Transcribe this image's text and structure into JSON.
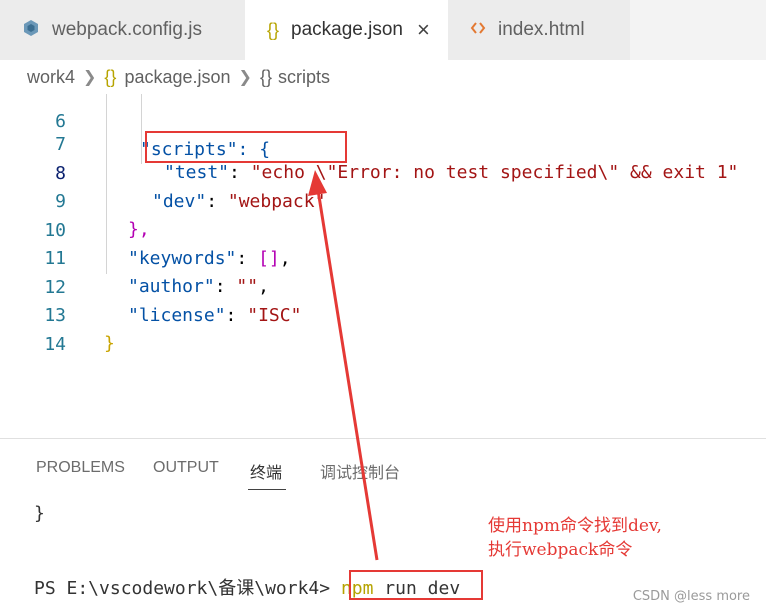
{
  "tabs": [
    {
      "label": "webpack.config.js",
      "icon": "webpack-icon",
      "active": false
    },
    {
      "label": "package.json",
      "icon": "json-braces-icon",
      "active": true
    },
    {
      "label": "index.html",
      "icon": "html-code-icon",
      "active": false
    }
  ],
  "tab_close_glyph": "×",
  "breadcrumb": {
    "root": "work4",
    "file_icon_glyph": "{}",
    "file": "package.json",
    "symbol_icon_glyph": "{}",
    "symbol": "scripts"
  },
  "editor": {
    "partial_line_number": "6",
    "partial_line_text": "\"scripts\": {",
    "lines": [
      {
        "n": "7",
        "key": "\"test\"",
        "value": "\"echo \\\"Error: no test specified\\\" && exit 1\""
      },
      {
        "n": "8",
        "key": "\"dev\"",
        "value": "\"webpack\""
      },
      {
        "n": "9",
        "text": "},"
      },
      {
        "n": "10",
        "key": "\"keywords\"",
        "value": "[]"
      },
      {
        "n": "11",
        "key": "\"author\"",
        "value": "\"\""
      },
      {
        "n": "12",
        "key": "\"license\"",
        "value": "\"ISC\""
      },
      {
        "n": "13",
        "text": "}"
      },
      {
        "n": "14",
        "text": ""
      }
    ]
  },
  "panel": {
    "tabs": [
      "PROBLEMS",
      "OUTPUT",
      "终端",
      "调试控制台"
    ],
    "active_tab": "终端",
    "terminal": {
      "brace_line": "}",
      "prompt": "PS E:\\vscodework\\备课\\work4>",
      "command_program": "npm",
      "command_args": "run dev"
    }
  },
  "annotation": {
    "line1": "使用npm命令找到dev,",
    "line2": "执行webpack命令",
    "color": "#e53935"
  },
  "watermark": "CSDN @less more",
  "colors": {
    "json_key": "#0451a5",
    "json_string": "#a31515",
    "line_number": "#237893",
    "bracket_yellow": "#c9a400",
    "bracket_magenta": "#b300b3",
    "annotation_red": "#e53935"
  }
}
